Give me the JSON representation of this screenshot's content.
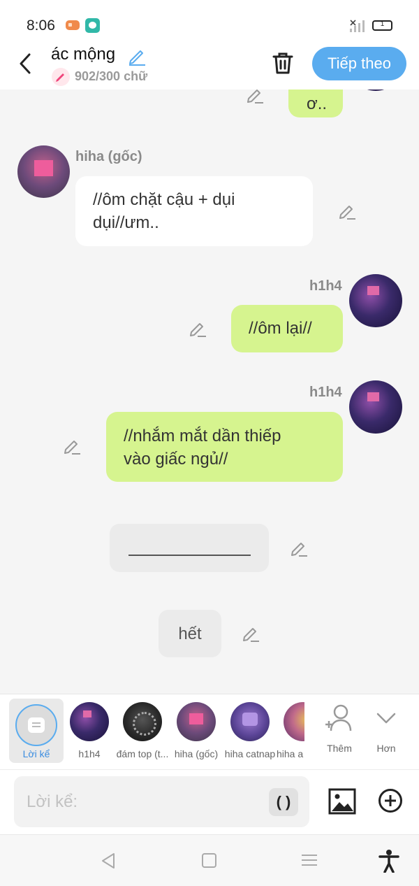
{
  "status_bar": {
    "time": "8:06",
    "battery_level": "1"
  },
  "header": {
    "title": "ác mộng",
    "word_count": "902/300 chữ",
    "next_label": "Tiếp theo"
  },
  "messages": [
    {
      "id": "m0",
      "type": "green",
      "text": "ơ.."
    },
    {
      "id": "m1",
      "type": "white",
      "sender": "hiha (gốc)",
      "text": "//ôm chặt cậu + dụi\ndụi//ưm.."
    },
    {
      "id": "m2",
      "type": "green",
      "sender": "h1h4",
      "text": "//ôm lại//"
    },
    {
      "id": "m3",
      "type": "green",
      "sender": "h1h4",
      "text": "//nhắm mắt dần thiếp\nvào giấc ngủ//"
    },
    {
      "id": "m4",
      "type": "narration",
      "text": ""
    },
    {
      "id": "m5",
      "type": "narration",
      "text": "hết"
    }
  ],
  "characters": {
    "narrator_label": "Lời kể",
    "items": [
      {
        "name": "h1h4"
      },
      {
        "name": "đám top (t..."
      },
      {
        "name": "hiha (gốc)"
      },
      {
        "name": "hiha catnap"
      },
      {
        "name": "hiha a"
      }
    ],
    "add_label": "Thêm",
    "more_label": "Hơn"
  },
  "input": {
    "placeholder": "Lời kể:",
    "paren_label": "( )"
  },
  "colors": {
    "accent": "#5aacef",
    "user_bubble": "#d6f48f",
    "other_bubble": "#ffffff",
    "narration_bubble": "#ebebeb"
  },
  "icons": [
    "game-icon",
    "chat-app-icon",
    "signal-icon",
    "battery-icon",
    "back-icon",
    "pencil-icon",
    "trash-icon",
    "edit-icon",
    "add-person-icon",
    "chevron-down-icon",
    "image-icon",
    "add-circle-icon",
    "nav-back-icon",
    "nav-home-icon",
    "nav-menu-icon",
    "accessibility-icon"
  ]
}
